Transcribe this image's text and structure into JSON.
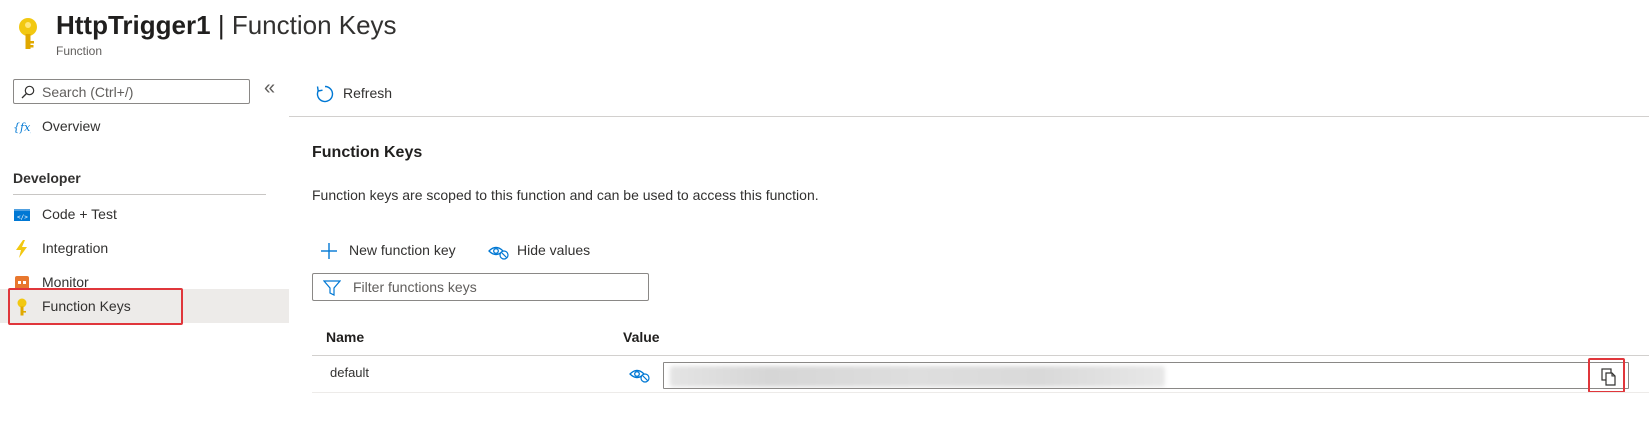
{
  "header": {
    "title": "HttpTrigger1",
    "separator": "|",
    "page": "Function Keys",
    "subtitle": "Function",
    "icon": "key-icon"
  },
  "sidebar": {
    "search_placeholder": "Search (Ctrl+/)",
    "collapse_glyph": "«",
    "overview": {
      "label": "Overview",
      "icon": "function-icon"
    },
    "section": "Developer",
    "items": [
      {
        "label": "Code + Test",
        "icon": "code-icon"
      },
      {
        "label": "Integration",
        "icon": "lightning-icon"
      },
      {
        "label": "Monitor",
        "icon": "monitor-icon"
      },
      {
        "label": "Function Keys",
        "icon": "key-icon",
        "selected": true
      }
    ]
  },
  "toolbar": {
    "refresh_label": "Refresh"
  },
  "content": {
    "title": "Function Keys",
    "description": "Function keys are scoped to this function and can be used to access this function.",
    "new_key_label": "New function key",
    "hide_values_label": "Hide values",
    "filter_placeholder": "Filter functions keys",
    "columns": [
      "Name",
      "Value"
    ],
    "rows": [
      {
        "name": "default"
      }
    ]
  },
  "colors": {
    "accent": "#0078d4",
    "key_yellow": "#f2c811",
    "highlight_red": "#e0363b",
    "selected_bg": "#edebe9"
  }
}
